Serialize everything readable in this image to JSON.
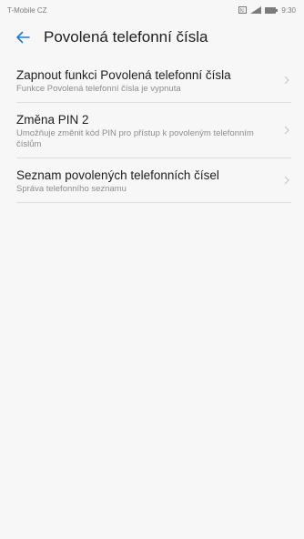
{
  "status_bar": {
    "carrier": "T-Mobile CZ",
    "time": "9:30",
    "icons": [
      "nfc-icon",
      "signal-icon",
      "battery-icon"
    ]
  },
  "app_bar": {
    "back_icon": "arrow-left-icon",
    "title": "Povolená telefonní čísla"
  },
  "items": [
    {
      "title": "Zapnout funkci Povolená telefonní čísla",
      "subtitle": "Funkce Povolená telefonní čísla je vypnuta"
    },
    {
      "title": "Změna PIN 2",
      "subtitle": "Umožňuje změnit kód PIN pro přístup k povoleným telefonním číslům"
    },
    {
      "title": "Seznam povolených telefonních čísel",
      "subtitle": "Správa telefonního seznamu"
    }
  ],
  "colors": {
    "accent": "#1a7ae6",
    "background": "#f7f7f7",
    "divider": "#dedede"
  }
}
